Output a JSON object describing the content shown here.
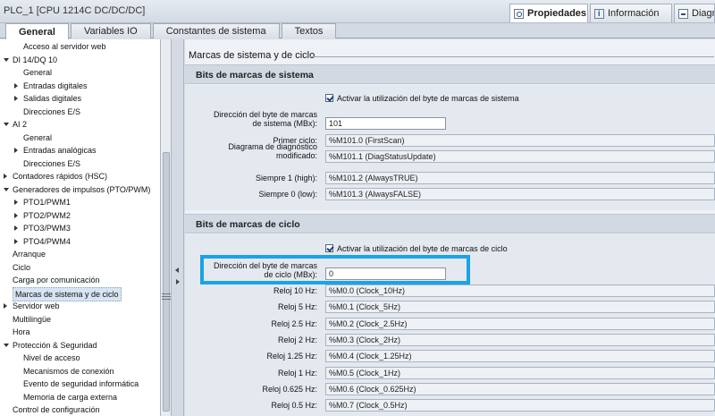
{
  "window": {
    "title": "PLC_1 [CPU 1214C DC/DC/DC]",
    "panel_tabs": [
      {
        "label": "Propiedades",
        "icon": "search-icon",
        "active": true
      },
      {
        "label": "Información",
        "icon": "info-icon",
        "active": false
      },
      {
        "label": "Diagnóstico",
        "icon": "diagnostics-icon",
        "active": false
      }
    ]
  },
  "subtabs": [
    {
      "label": "General",
      "active": true
    },
    {
      "label": "Variables IO",
      "active": false
    },
    {
      "label": "Constantes de sistema",
      "active": false
    },
    {
      "label": "Textos",
      "active": false
    }
  ],
  "tree": {
    "items": [
      {
        "label": "Acceso al servidor web",
        "indent": 1,
        "arrow": "none"
      },
      {
        "label": "DI 14/DQ 10",
        "indent": 0,
        "arrow": "down"
      },
      {
        "label": "General",
        "indent": 1,
        "arrow": "none"
      },
      {
        "label": "Entradas digitales",
        "indent": 1,
        "arrow": "right"
      },
      {
        "label": "Salidas digitales",
        "indent": 1,
        "arrow": "right"
      },
      {
        "label": "Direcciones E/S",
        "indent": 1,
        "arrow": "none"
      },
      {
        "label": "AI 2",
        "indent": 0,
        "arrow": "down"
      },
      {
        "label": "General",
        "indent": 1,
        "arrow": "none"
      },
      {
        "label": "Entradas analógicas",
        "indent": 1,
        "arrow": "right"
      },
      {
        "label": "Direcciones E/S",
        "indent": 1,
        "arrow": "none"
      },
      {
        "label": "Contadores rápidos (HSC)",
        "indent": 0,
        "arrow": "right"
      },
      {
        "label": "Generadores de impulsos (PTO/PWM)",
        "indent": 0,
        "arrow": "down"
      },
      {
        "label": "PTO1/PWM1",
        "indent": 1,
        "arrow": "right"
      },
      {
        "label": "PTO2/PWM2",
        "indent": 1,
        "arrow": "right"
      },
      {
        "label": "PTO3/PWM3",
        "indent": 1,
        "arrow": "right"
      },
      {
        "label": "PTO4/PWM4",
        "indent": 1,
        "arrow": "right"
      },
      {
        "label": "Arranque",
        "indent": 0,
        "arrow": "none"
      },
      {
        "label": "Ciclo",
        "indent": 0,
        "arrow": "none"
      },
      {
        "label": "Carga por comunicación",
        "indent": 0,
        "arrow": "none"
      },
      {
        "label": "Marcas de sistema y de ciclo",
        "indent": 0,
        "arrow": "none",
        "selected": true
      },
      {
        "label": "Servidor web",
        "indent": 0,
        "arrow": "right"
      },
      {
        "label": "Multilingüe",
        "indent": 0,
        "arrow": "none"
      },
      {
        "label": "Hora",
        "indent": 0,
        "arrow": "none"
      },
      {
        "label": "Protección & Seguridad",
        "indent": 0,
        "arrow": "down"
      },
      {
        "label": "Nivel de acceso",
        "indent": 1,
        "arrow": "none"
      },
      {
        "label": "Mecanismos de conexión",
        "indent": 1,
        "arrow": "none"
      },
      {
        "label": "Evento de seguridad informática",
        "indent": 1,
        "arrow": "none"
      },
      {
        "label": "Memoria de carga externa",
        "indent": 1,
        "arrow": "none"
      },
      {
        "label": "Control de configuración",
        "indent": 0,
        "arrow": "none"
      }
    ]
  },
  "main": {
    "title": "Marcas de sistema y de ciclo",
    "system": {
      "heading": "Bits de marcas de sistema",
      "checkbox_label": "Activar la utilización del byte de marcas de sistema",
      "address_label_1": "Dirección del byte de marcas",
      "address_label_2": "de sistema (MBx):",
      "address_value": "101",
      "rows": [
        {
          "label": "Primer ciclo:",
          "value": "%M101.0 (FirstScan)"
        },
        {
          "label": "Diagrama de diagnóstico",
          "label2": "modificado:",
          "value": "%M101.1 (DiagStatusUpdate)"
        },
        {
          "label": "Siempre 1 (high):",
          "value": "%M101.2 (AlwaysTRUE)"
        },
        {
          "label": "Siempre 0 (low):",
          "value": "%M101.3 (AlwaysFALSE)"
        }
      ]
    },
    "clock": {
      "heading": "Bits de marcas de ciclo",
      "checkbox_label": "Activar la utilización del byte de marcas de ciclo",
      "address_label_1": "Dirección del byte de marcas",
      "address_label_2": "de ciclo (MBx):",
      "address_value": "0",
      "rows": [
        {
          "label": "Reloj 10 Hz:",
          "value": "%M0.0 (Clock_10Hz)"
        },
        {
          "label": "Reloj 5 Hz:",
          "value": "%M0.1 (Clock_5Hz)"
        },
        {
          "label": "Reloj 2.5 Hz:",
          "value": "%M0.2 (Clock_2.5Hz)"
        },
        {
          "label": "Reloj 2 Hz:",
          "value": "%M0.3 (Clock_2Hz)"
        },
        {
          "label": "Reloj 1.25 Hz:",
          "value": "%M0.4 (Clock_1.25Hz)"
        },
        {
          "label": "Reloj 1 Hz:",
          "value": "%M0.5 (Clock_1Hz)"
        },
        {
          "label": "Reloj 0.625 Hz:",
          "value": "%M0.6 (Clock_0.625Hz)"
        },
        {
          "label": "Reloj 0.5 Hz:",
          "value": "%M0.7 (Clock_0.5Hz)"
        }
      ]
    }
  },
  "colors": {
    "highlight": "#1aa3e6",
    "checkmark": "#1a3f8a"
  }
}
